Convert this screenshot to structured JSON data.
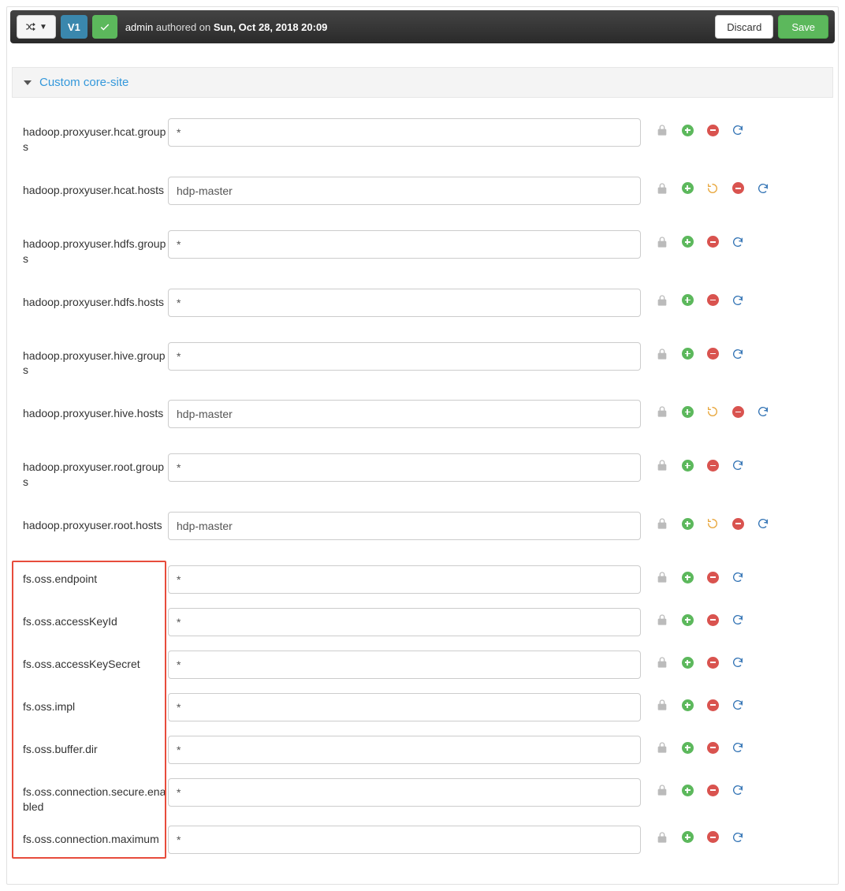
{
  "header": {
    "versionLabel": "V1",
    "user": "admin",
    "authoredText": "authored on",
    "date": "Sun, Oct 28, 2018 20:09",
    "discardLabel": "Discard",
    "saveLabel": "Save"
  },
  "section": {
    "title": "Custom core-site"
  },
  "properties": [
    {
      "key": "hadoop.proxyuser.hcat.groups",
      "value": "*",
      "undo": false
    },
    {
      "key": "hadoop.proxyuser.hcat.hosts",
      "value": "hdp-master",
      "undo": true
    },
    {
      "key": "hadoop.proxyuser.hdfs.groups",
      "value": "*",
      "undo": false
    },
    {
      "key": "hadoop.proxyuser.hdfs.hosts",
      "value": "*",
      "undo": false
    },
    {
      "key": "hadoop.proxyuser.hive.groups",
      "value": "*",
      "undo": false
    },
    {
      "key": "hadoop.proxyuser.hive.hosts",
      "value": "hdp-master",
      "undo": true
    },
    {
      "key": "hadoop.proxyuser.root.groups",
      "value": "*",
      "undo": false
    },
    {
      "key": "hadoop.proxyuser.root.hosts",
      "value": "hdp-master",
      "undo": true
    },
    {
      "key": "fs.oss.endpoint",
      "value": "*",
      "undo": false
    },
    {
      "key": "fs.oss.accessKeyId",
      "value": "*",
      "undo": false
    },
    {
      "key": "fs.oss.accessKeySecret",
      "value": "*",
      "undo": false
    },
    {
      "key": "fs.oss.impl",
      "value": "*",
      "undo": false
    },
    {
      "key": "fs.oss.buffer.dir",
      "value": "*",
      "undo": false
    },
    {
      "key": "fs.oss.connection.secure.enabled",
      "value": "*",
      "undo": false
    },
    {
      "key": "fs.oss.connection.maximum",
      "value": "*",
      "undo": false
    }
  ],
  "highlight": {
    "fromIndex": 8,
    "toIndex": 14
  }
}
